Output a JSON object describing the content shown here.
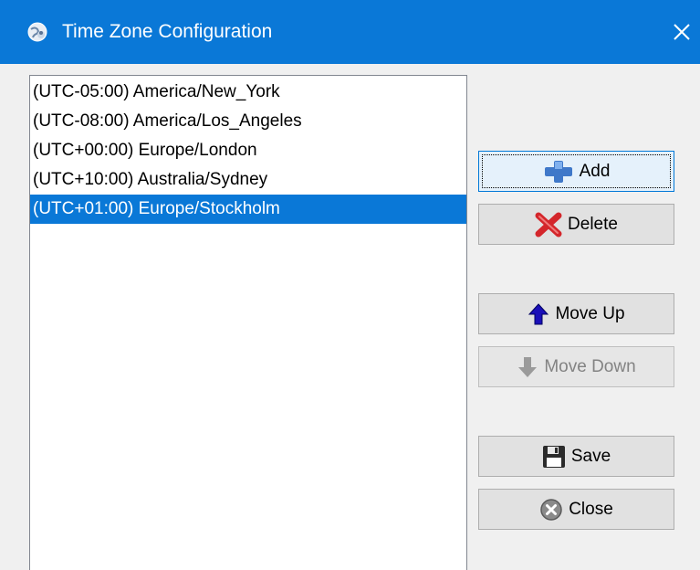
{
  "window": {
    "title": "Time Zone Configuration",
    "icon": "globe-people-icon",
    "close_icon": "close-icon"
  },
  "timezones": {
    "items": [
      {
        "label": "(UTC-05:00) America/New_York",
        "selected": false
      },
      {
        "label": "(UTC-08:00) America/Los_Angeles",
        "selected": false
      },
      {
        "label": "(UTC+00:00) Europe/London",
        "selected": false
      },
      {
        "label": "(UTC+10:00) Australia/Sydney",
        "selected": false
      },
      {
        "label": "(UTC+01:00) Europe/Stockholm",
        "selected": true
      }
    ]
  },
  "buttons": {
    "add": {
      "label": "Add",
      "icon": "plus-icon",
      "focused": true
    },
    "delete": {
      "label": "Delete",
      "icon": "red-x-icon"
    },
    "move_up": {
      "label": "Move Up",
      "icon": "arrow-up-icon"
    },
    "move_down": {
      "label": "Move Down",
      "icon": "arrow-down-icon",
      "disabled": true
    },
    "save": {
      "label": "Save",
      "icon": "floppy-disk-icon"
    },
    "close": {
      "label": "Close",
      "icon": "close-circle-icon"
    }
  },
  "colors": {
    "titlebar": "#0a78d7",
    "selection": "#0a78d7",
    "window_bg": "#f0f0f0"
  }
}
